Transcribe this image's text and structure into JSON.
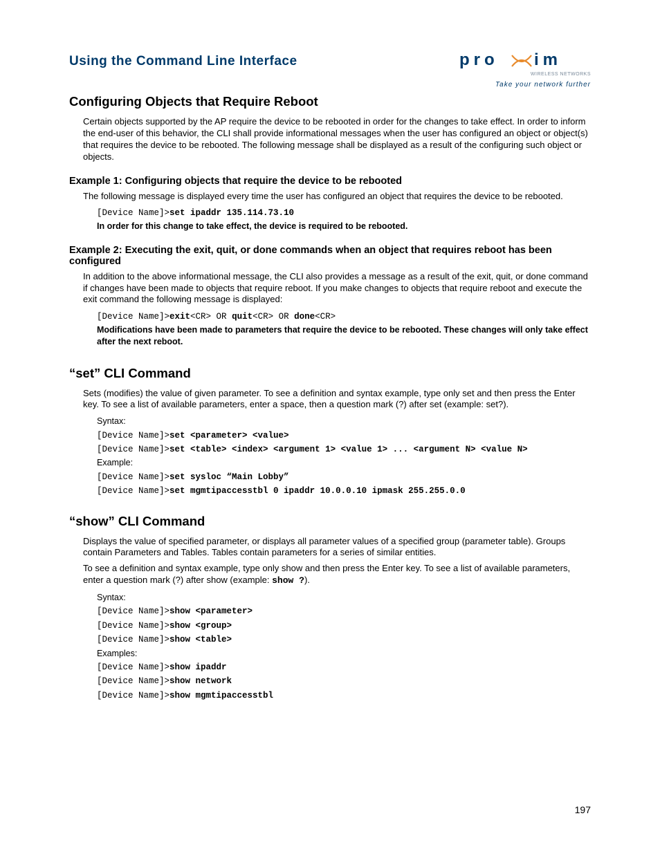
{
  "header": {
    "title": "Using the Command Line Interface",
    "logo_text": "proxim",
    "logo_sub": "WIRELESS NETWORKS",
    "tagline": "Take your network further"
  },
  "s1": {
    "heading": "Configuring Objects that Require Reboot",
    "p1": "Certain objects supported by the AP require the device to be rebooted in order for the changes to take effect. In order to inform the end-user of this behavior, the CLI shall provide informational messages when the user has configured an object or object(s) that requires the device to be rebooted. The following message shall be displayed as a result of the configuring such object or objects.",
    "ex1_h": "Example 1: Configuring objects that require the device to be rebooted",
    "ex1_p": "The following message is displayed every time the user has configured an object that requires the device to be rebooted.",
    "ex1_prompt": "[Device Name]>",
    "ex1_cmd": "set ipaddr 135.114.73.10",
    "ex1_note": "In order for this change to take effect, the device is required to be rebooted.",
    "ex2_h": "Example 2: Executing the exit, quit, or done commands when an object that requires reboot has been configured",
    "ex2_p": "In addition to the above informational message, the CLI also provides a message as a result of the exit, quit, or done command if changes have been made to objects that require reboot. If you make changes to objects that require reboot and execute the exit command the following message is displayed:",
    "ex2_prompt": "[Device Name]>",
    "ex2_cmd1": "exit",
    "ex2_or": "<CR> OR ",
    "ex2_cmd2": "quit",
    "ex2_or2": "<CR> OR ",
    "ex2_cmd3": "done",
    "ex2_tail": "<CR>",
    "ex2_note": "Modifications have been made to parameters that require the device to be rebooted. These changes will only take effect after the next reboot."
  },
  "s2": {
    "heading": "“set” CLI Command",
    "p1": "Sets (modifies) the value of given parameter. To see a definition and syntax example, type only set and then press the Enter key. To see a list of available parameters, enter a space, then a question mark (?) after set (example: set?).",
    "syntax_label": "Syntax:",
    "prompt": "[Device Name]>",
    "l1": "set <parameter> <value>",
    "l2": "set <table> <index> <argument 1> <value 1> ... <argument N> <value N>",
    "example_label": "Example:",
    "l3": "set sysloc “Main Lobby”",
    "l4": "set mgmtipaccesstbl 0 ipaddr 10.0.0.10 ipmask 255.255.0.0"
  },
  "s3": {
    "heading": "“show” CLI Command",
    "p1": "Displays the value of specified parameter, or displays all parameter values of a specified group (parameter table). Groups contain Parameters and Tables. Tables contain parameters for a series of similar entities.",
    "p2a": "To see a definition and syntax example, type only show and then press the Enter key. To see a list of available parameters, enter a question mark (?) after show (example: ",
    "p2_mono": "show ?",
    "p2b": ").",
    "syntax_label": "Syntax:",
    "prompt": "[Device Name]>",
    "l1": "show <parameter>",
    "l2": "show <group>",
    "l3": "show <table>",
    "examples_label": "Examples:",
    "l4": "show ipaddr",
    "l5": "show network",
    "l6": "show mgmtipaccesstbl"
  },
  "pagenum": "197"
}
